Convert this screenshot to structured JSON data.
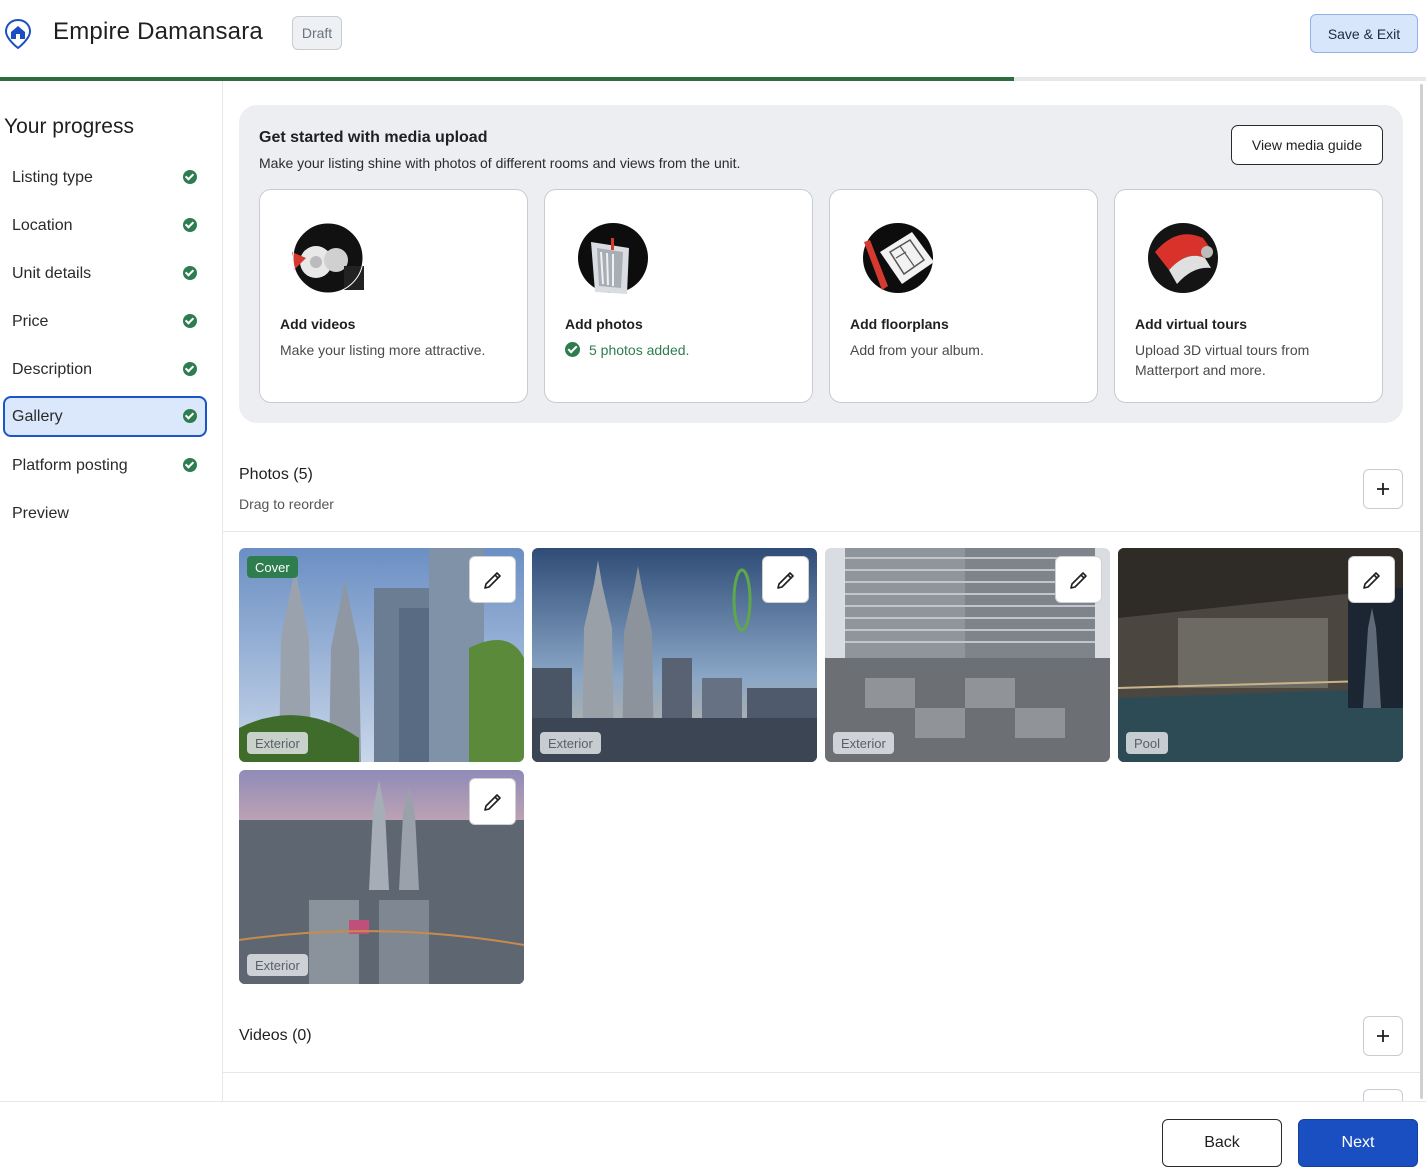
{
  "header": {
    "logo_icon": "home-pin-icon",
    "title": "Empire Damansara",
    "status_badge": "Draft",
    "save_exit_label": "Save & Exit",
    "progress_fraction": 0.711
  },
  "sidebar": {
    "heading": "Your progress",
    "items": [
      {
        "label": "Listing type",
        "completed": true,
        "active": false
      },
      {
        "label": "Location",
        "completed": true,
        "active": false
      },
      {
        "label": "Unit details",
        "completed": true,
        "active": false
      },
      {
        "label": "Price",
        "completed": true,
        "active": false
      },
      {
        "label": "Description",
        "completed": true,
        "active": false
      },
      {
        "label": "Gallery",
        "completed": true,
        "active": true
      },
      {
        "label": "Platform posting",
        "completed": true,
        "active": false
      },
      {
        "label": "Preview",
        "completed": false,
        "active": false
      }
    ]
  },
  "media_upload": {
    "title": "Get started with media upload",
    "subtitle": "Make your listing shine with photos of different rooms and views from the unit.",
    "guide_button": "View media guide",
    "cards": [
      {
        "title": "Add videos",
        "description": "Make your listing more attractive.",
        "icon": "video-reel-icon"
      },
      {
        "title": "Add photos",
        "description": "5 photos added.",
        "icon": "photo-stack-icon"
      },
      {
        "title": "Add floorplans",
        "description": "Add from your album.",
        "icon": "floorplan-icon"
      },
      {
        "title": "Add virtual tours",
        "description": "Upload 3D virtual tours from Matterport and more.",
        "icon": "vr-headset-icon"
      }
    ]
  },
  "photos": {
    "title": "Photos (5)",
    "subtitle": "Drag to reorder",
    "cover_label": "Cover",
    "items": [
      {
        "tag": "Exterior"
      },
      {
        "tag": "Exterior"
      },
      {
        "tag": "Exterior"
      },
      {
        "tag": "Pool"
      },
      {
        "tag": "Exterior"
      }
    ]
  },
  "videos": {
    "title": "Videos (0)"
  },
  "footer": {
    "back_label": "Back",
    "next_label": "Next"
  },
  "colors": {
    "primary": "#1a4fc2",
    "success": "#2e7d4f",
    "active_nav_bg": "#dbe8fc",
    "panel_bg": "#eceef2"
  }
}
